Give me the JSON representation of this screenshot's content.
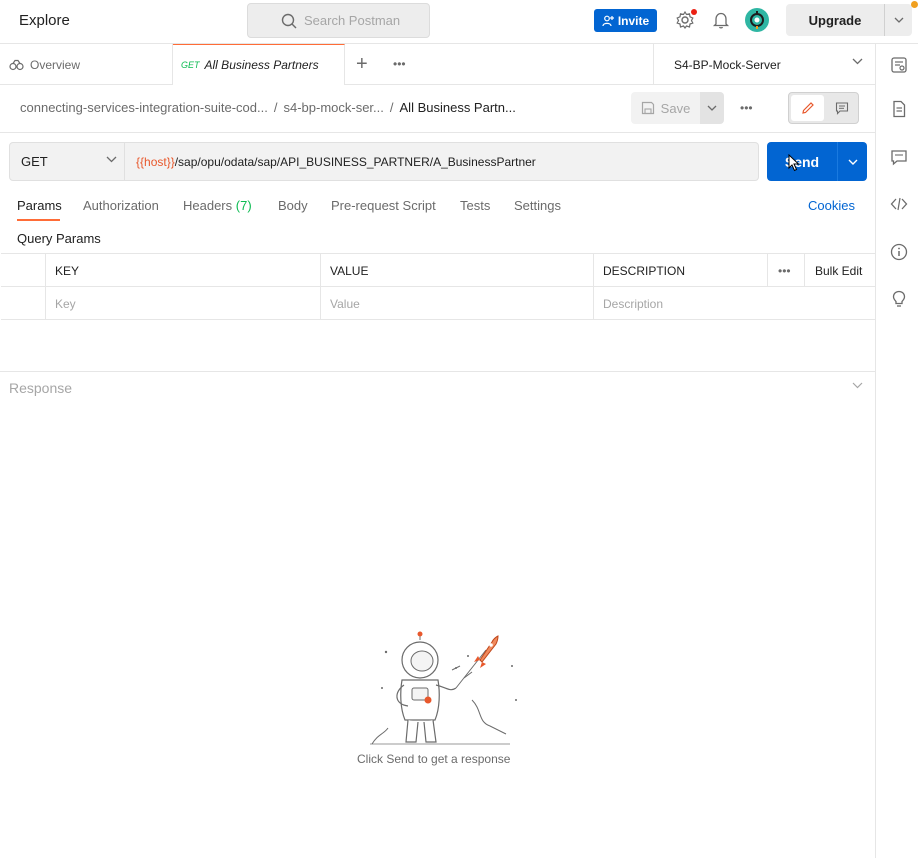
{
  "header": {
    "explore": "Explore",
    "search_placeholder": "Search Postman",
    "invite_label": "Invite",
    "upgrade_label": "Upgrade"
  },
  "tabs": {
    "overview_label": "Overview",
    "active_method": "GET",
    "active_label": "All Business Partners",
    "environment": "S4-BP-Mock-Server"
  },
  "breadcrumb": {
    "collection": "connecting-services-integration-suite-cod...",
    "folder": "s4-bp-mock-ser...",
    "request": "All Business Partn...",
    "save_label": "Save"
  },
  "request": {
    "method": "GET",
    "url_variable": "{{host}}",
    "url_path": "/sap/opu/odata/sap/API_BUSINESS_PARTNER/A_BusinessPartner",
    "send_label": "Send"
  },
  "request_tabs": {
    "params": "Params",
    "authorization": "Authorization",
    "headers": "Headers",
    "headers_count": "(7)",
    "body": "Body",
    "prerequest": "Pre-request Script",
    "tests": "Tests",
    "settings": "Settings",
    "cookies": "Cookies"
  },
  "params": {
    "section_label": "Query Params",
    "col_key": "KEY",
    "col_value": "VALUE",
    "col_description": "DESCRIPTION",
    "bulk_edit": "Bulk Edit",
    "key_placeholder": "Key",
    "value_placeholder": "Value",
    "description_placeholder": "Description"
  },
  "response": {
    "title": "Response",
    "empty_message": "Click Send to get a response"
  },
  "colors": {
    "brand_orange": "#ff6c37",
    "primary_blue": "#0265d2",
    "get_green": "#0cbb52",
    "variable_orange": "#e8582c"
  }
}
